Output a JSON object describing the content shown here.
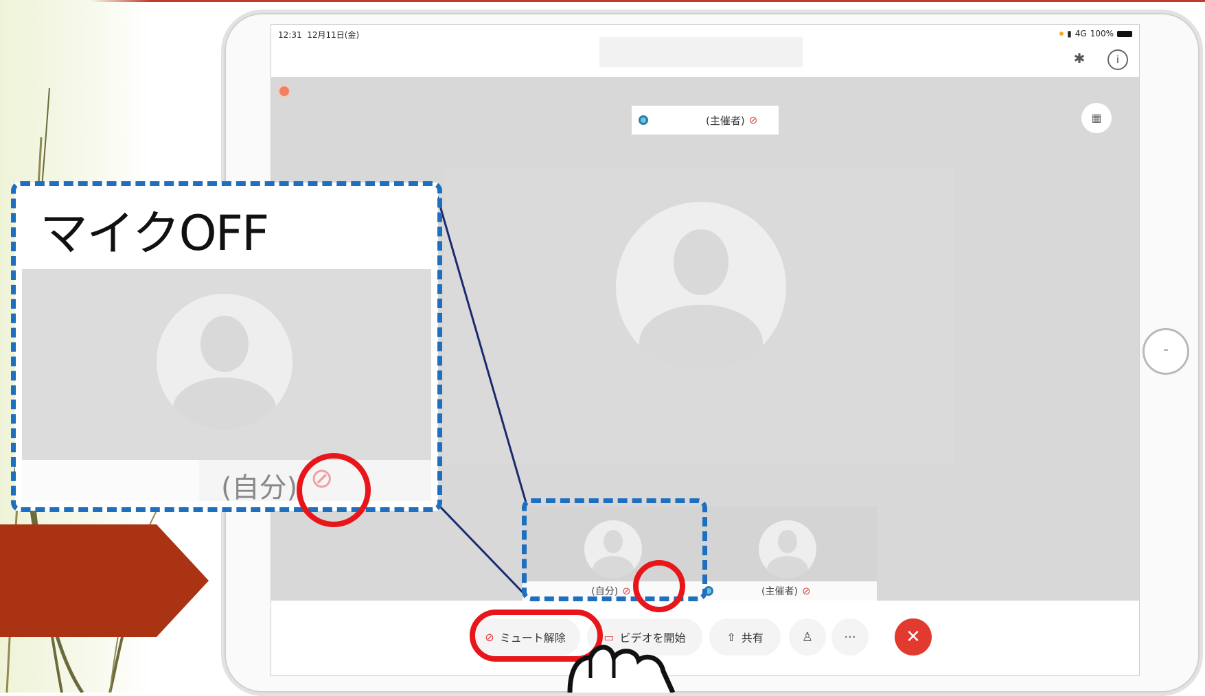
{
  "slide": {
    "accent_color": "#c0392b",
    "arrow_color": "#a93312"
  },
  "status_bar": {
    "time": "12:31",
    "date": "12月11日(金)",
    "signal": "4G",
    "battery": "100%"
  },
  "meeting": {
    "host_label": "(主催者)",
    "self_label": "(自分)",
    "host_thumb_label": "(主催者)"
  },
  "toolbar": {
    "unmute_label": "ミュート解除",
    "video_label": "ビデオを開始",
    "share_label": "共有",
    "more_label": "···",
    "end_label": "✕"
  },
  "callout": {
    "title": "マイクOFF",
    "self_label": "(自分)",
    "highlight_color": "#e8161b",
    "dash_color": "#1f6fc0"
  }
}
